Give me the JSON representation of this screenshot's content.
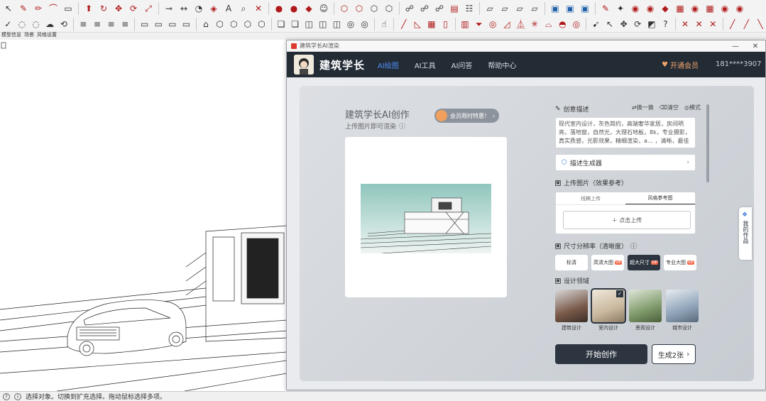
{
  "app": {
    "window_title": "建筑学长AI渲染",
    "brand": "建筑学长",
    "nav": [
      "AI绘图",
      "AI工具",
      "AI问答",
      "帮助中心"
    ],
    "active_nav": 0,
    "vip_label": "开通会员",
    "user": "181****3907"
  },
  "sketchup": {
    "tabs": [
      "模型信息",
      "场景",
      "风格设置"
    ],
    "status_text": "选择对象。切换到扩充选择。拖动鼠标选择多项。"
  },
  "left": {
    "title": "建筑学长AI创作",
    "subtitle": "上传图片即可渲染",
    "vip_pill": "会员限时特惠！",
    "preview_alt": "建筑渲染预览"
  },
  "right": {
    "desc_header": "创意描述",
    "desc_actions": [
      "换一换",
      "清空",
      "模式"
    ],
    "desc_text": "现代室内设计，灰色简约，高端奢华家居，房间明亮，落地窗，自然光，大理石地板，8k，专业摄影，真实质感，光影效果，精细渲染，a… ，清晰，最佳",
    "desc_gen": "描述生成器",
    "upload_header": "上传图片（效果参考）",
    "upload_tabs": [
      "线稿上传",
      "风格参考图"
    ],
    "active_upload_tab": 1,
    "upload_btn": "＋ 点击上传",
    "size_header": "尺寸分辨率（清晰度）",
    "sizes": [
      {
        "label": "标清",
        "tag": ""
      },
      {
        "label": "高清大图",
        "tag": "VIP"
      },
      {
        "label": "超大尺寸",
        "tag": "VIP"
      },
      {
        "label": "专业大图",
        "tag": "VIP"
      }
    ],
    "active_size": 2,
    "style_header": "设计领域",
    "styles": [
      {
        "name": "建筑设计",
        "color": "#7a5a4a"
      },
      {
        "name": "室内设计",
        "color": "#c9b89e"
      },
      {
        "name": "景观设计",
        "color": "#7f9a6a"
      },
      {
        "name": "城市设计",
        "color": "#8fa3b8"
      }
    ],
    "active_style": 1,
    "start_btn": "开始创作",
    "gen2_btn": "生成2张"
  },
  "sidetab": "我的作品"
}
